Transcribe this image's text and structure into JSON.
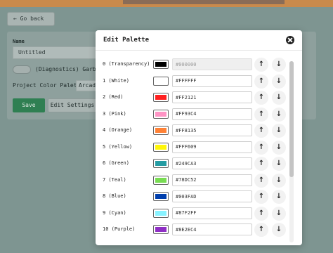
{
  "background": {
    "back_button": "Go back",
    "name_label": "Name",
    "name_value": "Untitled",
    "diagnostics_label": "(Diagnostics) Garbage",
    "palette_label": "Project Color Palette:",
    "palette_value": "Arcade",
    "save_label": "Save",
    "edit_settings_label": "Edit Settings"
  },
  "modal": {
    "title": "Edit Palette",
    "colors": [
      {
        "label": "0 (Transparency)",
        "hex": "#000000",
        "disabled": true
      },
      {
        "label": "1 (White)",
        "hex": "#FFFFFF"
      },
      {
        "label": "2 (Red)",
        "hex": "#FF2121"
      },
      {
        "label": "3 (Pink)",
        "hex": "#FF93C4"
      },
      {
        "label": "4 (Orange)",
        "hex": "#FF8135"
      },
      {
        "label": "5 (Yellow)",
        "hex": "#FFF609"
      },
      {
        "label": "6 (Green)",
        "hex": "#249CA3"
      },
      {
        "label": "7 (Teal)",
        "hex": "#78DC52"
      },
      {
        "label": "8 (Blue)",
        "hex": "#003FAD"
      },
      {
        "label": "9 (Cyan)",
        "hex": "#87F2FF"
      },
      {
        "label": "10 (Purple)",
        "hex": "#8E2EC4"
      }
    ],
    "icons": {
      "up": "arrow-up-icon",
      "down": "arrow-down-icon",
      "close": "close-icon"
    }
  }
}
